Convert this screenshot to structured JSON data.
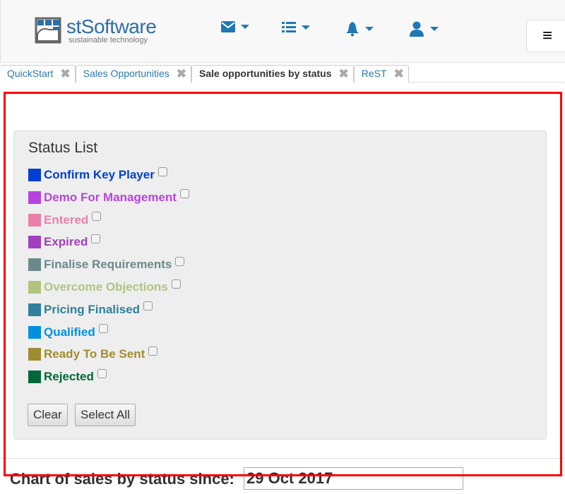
{
  "header": {
    "logo_name": "stSoftware",
    "logo_tagline": "sustainable technology",
    "nav": [
      {
        "icon": "envelope-icon"
      },
      {
        "icon": "list-icon"
      },
      {
        "icon": "bell-icon"
      },
      {
        "icon": "user-icon"
      }
    ],
    "menu_icon": "≡"
  },
  "tabs": [
    {
      "label": "QuickStart"
    },
    {
      "label": "Sales Opportunities"
    },
    {
      "label": "Sale opportunities by status",
      "active": true
    },
    {
      "label": "ReST"
    }
  ],
  "tab_close": "✖",
  "status_list": {
    "title": "Status List",
    "items": [
      {
        "label": "Confirm Key Player",
        "color": "#0040d0",
        "checked": false
      },
      {
        "label": "Demo For Management",
        "color": "#b844e0",
        "checked": false
      },
      {
        "label": "Entered",
        "color": "#ea80aa",
        "checked": false
      },
      {
        "label": "Expired",
        "color": "#a040c0",
        "checked": false
      },
      {
        "label": "Finalise Requirements",
        "color": "#6a8a8a",
        "checked": false
      },
      {
        "label": "Overcome Objections",
        "color": "#b0c480",
        "checked": false
      },
      {
        "label": "Pricing Finalised",
        "color": "#30809c",
        "checked": false
      },
      {
        "label": "Qualified",
        "color": "#0090e0",
        "checked": false
      },
      {
        "label": "Ready To Be Sent",
        "color": "#a08c30",
        "checked": false
      },
      {
        "label": "Rejected",
        "color": "#006838",
        "checked": false
      }
    ],
    "clear_label": "Clear",
    "select_all_label": "Select All"
  },
  "chart": {
    "heading": "Chart of sales by status since:",
    "since_value": "29 Oct 2017"
  }
}
